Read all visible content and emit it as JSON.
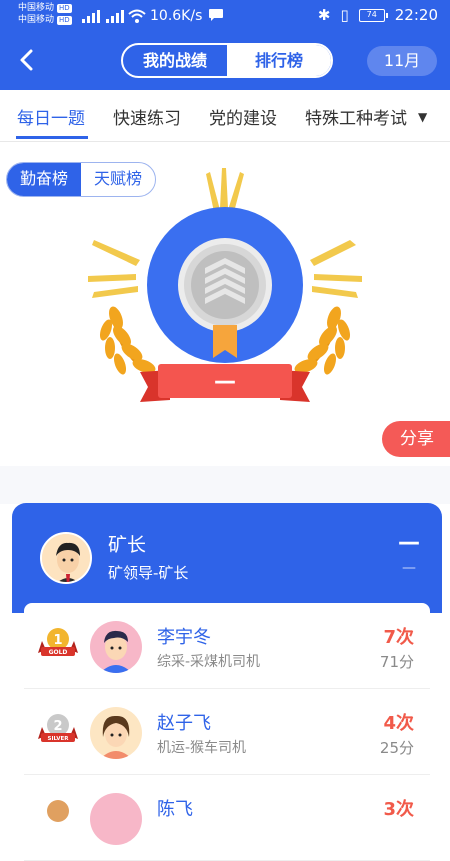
{
  "status_bar": {
    "carrier_1": "中国移动",
    "carrier_2": "中国移动",
    "hd_1": "HD",
    "hd_2": "HD",
    "speed": "10.6K/s",
    "battery": "74",
    "time": "22:20",
    "icons": [
      "signal-icon",
      "wifi-icon",
      "chat-icon",
      "bluetooth-icon",
      "vibrate-icon",
      "battery-icon"
    ]
  },
  "header": {
    "back_icon": "back-chevron-icon",
    "seg_left": "我的战绩",
    "seg_right": "排行榜",
    "month": "11月"
  },
  "tabs": {
    "items": [
      "每日一题",
      "快速练习",
      "党的建设",
      "特殊工种考试"
    ],
    "active_index": 0,
    "more_icon": "caret-down-icon"
  },
  "toggle": {
    "left": "勤奋榜",
    "right": "天赋榜"
  },
  "badge": {
    "ribbon_text": "—",
    "icon": "rank-badge-icon"
  },
  "share_label": "分享",
  "my_entry": {
    "name": "矿长",
    "role": "矿领导-矿长",
    "rank": "—",
    "score": "—"
  },
  "ranking": [
    {
      "medal": "gold-medal-icon",
      "medal_text": "GOLD",
      "name": "李宇冬",
      "role": "综采-采煤机司机",
      "count": "7次",
      "score": "71分"
    },
    {
      "medal": "silver-medal-icon",
      "medal_text": "SILVER",
      "name": "赵子飞",
      "role": "机运-猴车司机",
      "count": "4次",
      "score": "25分"
    },
    {
      "medal": "bronze-medal-icon",
      "medal_text": "",
      "name": "陈飞",
      "role": "",
      "count": "3次",
      "score": ""
    }
  ],
  "colors": {
    "primary": "#2f63e8",
    "accent_red": "#f45a57",
    "gold": "#f2b52e"
  }
}
